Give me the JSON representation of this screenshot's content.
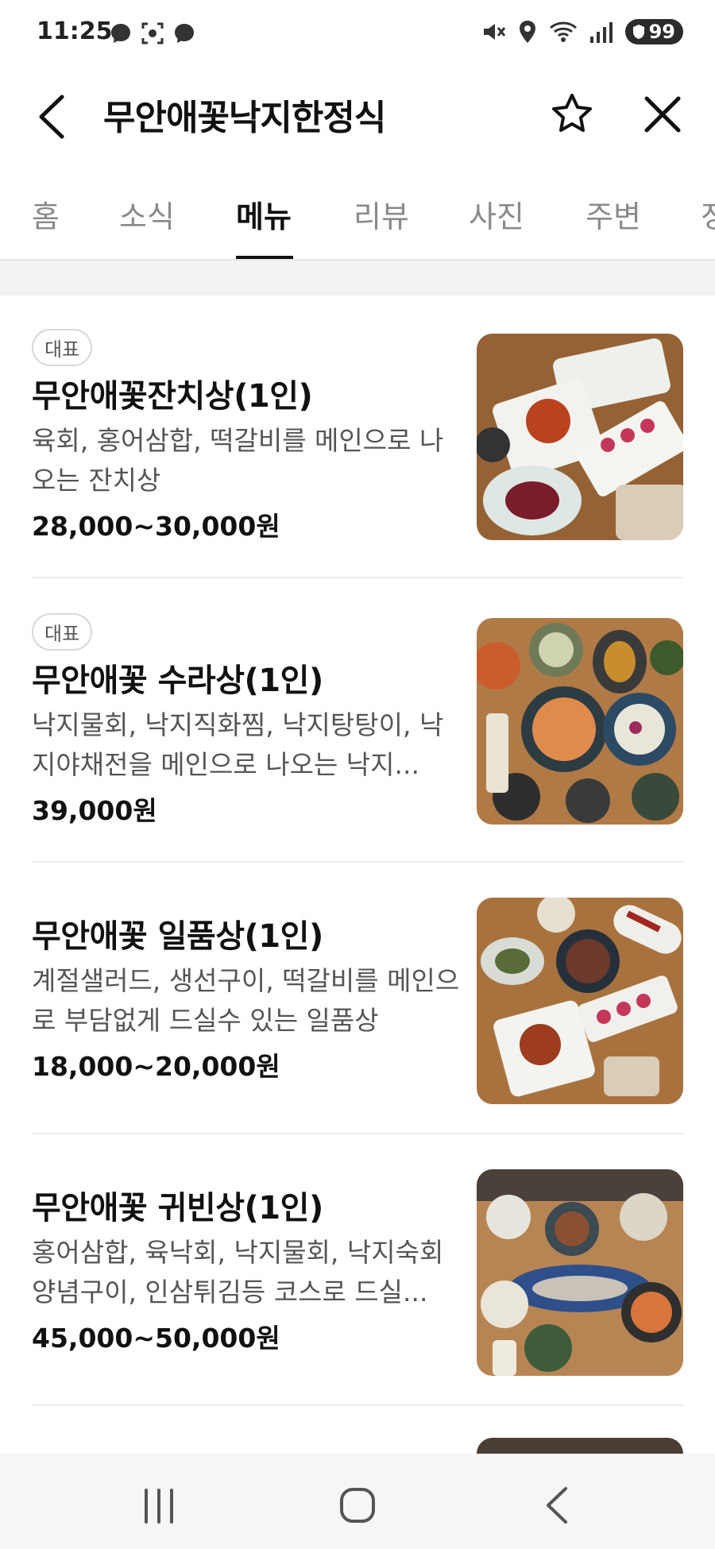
{
  "status": {
    "time": "11:25",
    "battery": "99"
  },
  "header": {
    "title": "무안애꽃낙지한정식"
  },
  "tabs": [
    {
      "label": "홈"
    },
    {
      "label": "소식"
    },
    {
      "label": "메뉴"
    },
    {
      "label": "리뷰"
    },
    {
      "label": "사진"
    },
    {
      "label": "주변"
    },
    {
      "label": "정"
    }
  ],
  "active_tab": "메뉴",
  "menu": [
    {
      "badge": "대표",
      "name": "무안애꽃잔치상(1인)",
      "desc": "육회, 홍어삼합, 떡갈비를 메인으로 나오는 잔치상",
      "price": "28,000~30,000원"
    },
    {
      "badge": "대표",
      "name": "무안애꽃 수라상(1인)",
      "desc": "낙지물회, 낙지직화찜, 낙지탕탕이, 낙지야채전을 메인으로 나오는 낙지...",
      "price": "39,000원"
    },
    {
      "name": "무안애꽃 일품상(1인)",
      "desc": "계절샐러드, 생선구이, 떡갈비를 메인으로 부담없게 드실수 있는 일품상",
      "price": "18,000~20,000원"
    },
    {
      "name": "무안애꽃 귀빈상(1인)",
      "desc": "홍어삼합, 육낙회, 낙지물회, 낙지숙회 양념구이, 인삼튀김등 코스로 드실...",
      "price": "45,000~50,000원"
    }
  ],
  "colors": {
    "text": "#111111",
    "muted": "#8a8a8a",
    "desc": "#555555",
    "wood": "#a06a3a"
  },
  "icons": {
    "back": "chevron-left-icon",
    "favorite": "star-outline-icon",
    "close": "close-icon"
  }
}
